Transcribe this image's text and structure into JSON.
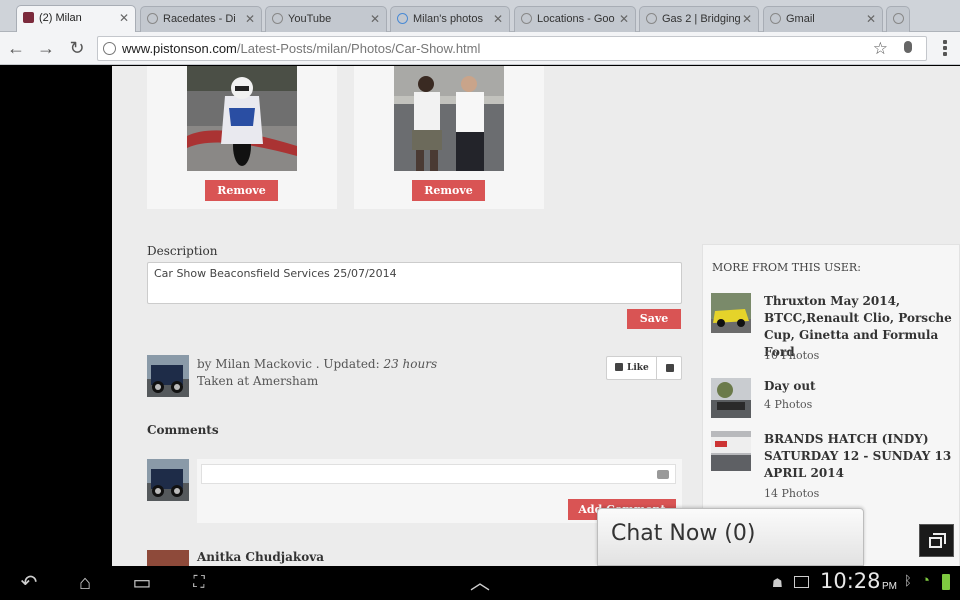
{
  "browser": {
    "tabs": [
      {
        "label": "(2) Milan",
        "active": true
      },
      {
        "label": "Racedates - Di"
      },
      {
        "label": "YouTube"
      },
      {
        "label": "Milan's photos"
      },
      {
        "label": "Locations - Goo"
      },
      {
        "label": "Gas 2 | Bridging"
      },
      {
        "label": "Gmail"
      }
    ],
    "url_domain": "www.pistonson.com",
    "url_path": "/Latest-Posts/milan/Photos/Car-Show.html"
  },
  "photos": {
    "remove_label": "Remove"
  },
  "description": {
    "label": "Description",
    "value": "Car Show Beaconsfield Services 25/07/2014",
    "save_label": "Save"
  },
  "author": {
    "by_text": "by Milan Mackovic . Updated: ",
    "updated": "23 hours",
    "location": "Taken at Amersham",
    "like_label": "Like"
  },
  "comments": {
    "label": "Comments",
    "add_label": "Add Comment",
    "first_commenter": "Anitka Chudjakova"
  },
  "sidebar": {
    "title": "MORE FROM THIS USER:",
    "items": [
      {
        "title": "Thruxton May 2014, BTCC,Renault Clio, Porsche Cup, Ginetta and Formula Ford",
        "count": "10 Photos"
      },
      {
        "title": "Day out",
        "count": "4 Photos"
      },
      {
        "title": "BRANDS HATCH (INDY) SATURDAY 12 - SUNDAY 13 APRIL 2014",
        "count": "14 Photos"
      }
    ]
  },
  "chat": {
    "label": "Chat Now (0)"
  },
  "system": {
    "time": "10:28",
    "ampm": "PM"
  }
}
